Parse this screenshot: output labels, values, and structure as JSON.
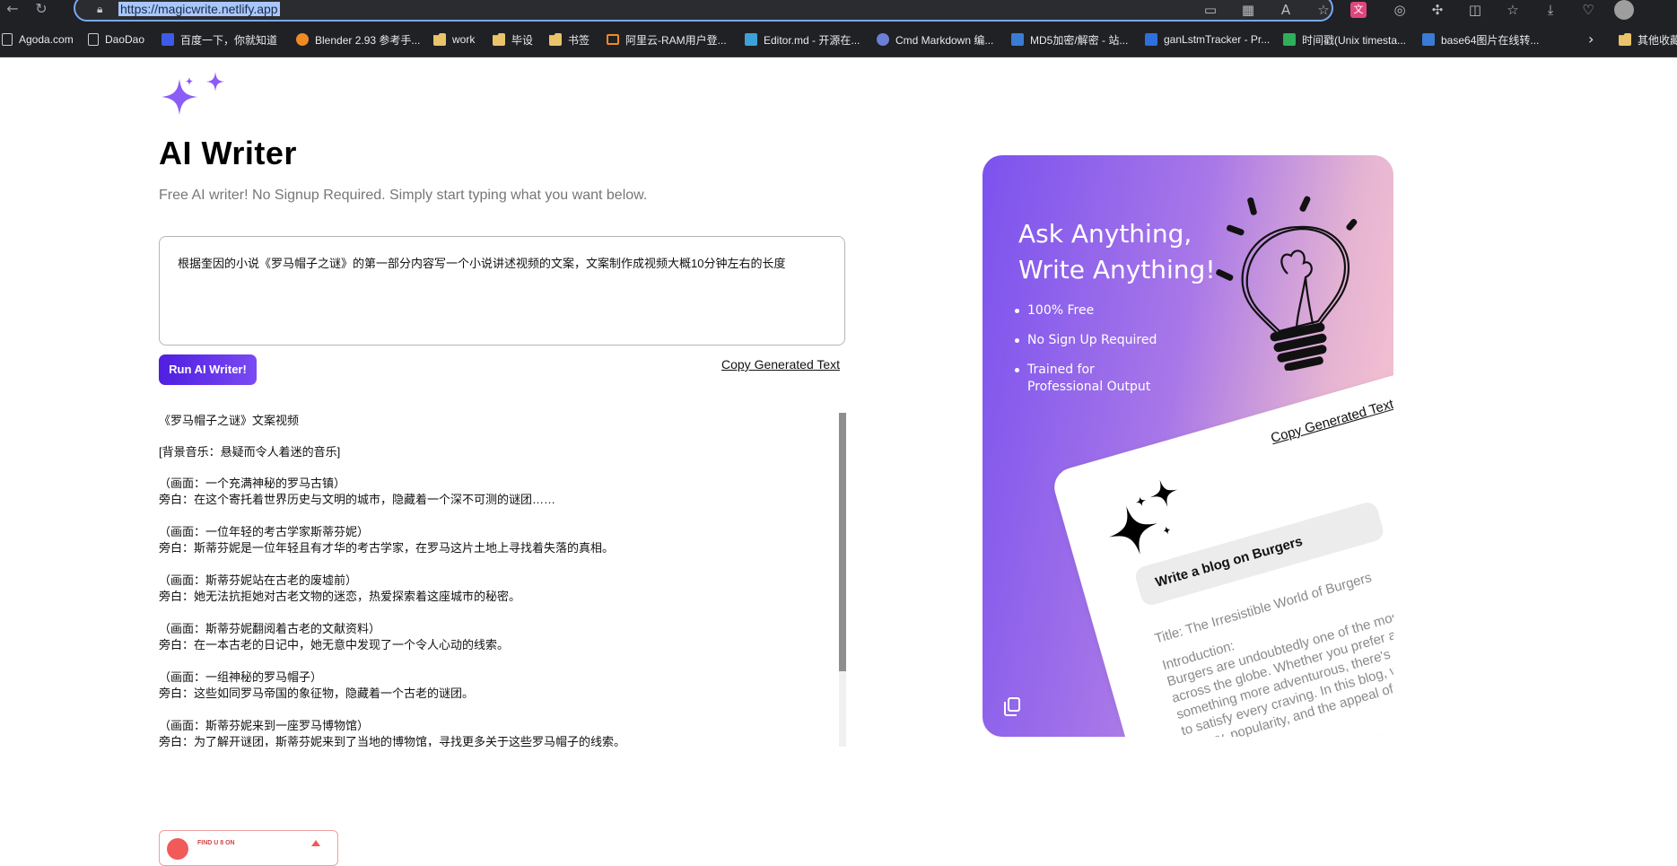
{
  "browser": {
    "url": "https://magicwrite.netlify.app",
    "bookmarks": [
      {
        "label": "Agoda.com",
        "kind": "page"
      },
      {
        "label": "DaoDao",
        "kind": "page"
      },
      {
        "label": "百度一下，你就知道",
        "kind": "baidu"
      },
      {
        "label": "Blender 2.93 参考手...",
        "kind": "blender"
      },
      {
        "label": "work",
        "kind": "folder"
      },
      {
        "label": "毕设",
        "kind": "folder"
      },
      {
        "label": "书签",
        "kind": "folder"
      },
      {
        "label": "阿里云-RAM用户登...",
        "kind": "aliyun"
      },
      {
        "label": "Editor.md - 开源在...",
        "kind": "editormd"
      },
      {
        "label": "Cmd Markdown 编...",
        "kind": "cmd"
      },
      {
        "label": "MD5加密/解密 - 站...",
        "kind": "md5"
      },
      {
        "label": "ganLstmTracker - Pr...",
        "kind": "on"
      },
      {
        "label": "时间戳(Unix timesta...",
        "kind": "time"
      },
      {
        "label": "base64图片在线转...",
        "kind": "md5"
      },
      {
        "label": "其他收藏",
        "kind": "folder"
      }
    ]
  },
  "page": {
    "title": "AI Writer",
    "subtitle": "Free AI writer! No Signup Required. Simply start typing what you want below.",
    "prompt_value": "根据奎因的小说《罗马帽子之谜》的第一部分内容写一个小说讲述视频的文案，文案制作成视频大概10分钟左右的长度",
    "run_button": "Run AI Writer!",
    "copy_link": "Copy Generated Text",
    "output": [
      [
        "《罗马帽子之谜》文案视频"
      ],
      [
        "[背景音乐：悬疑而令人着迷的音乐]"
      ],
      [
        "（画面：一个充满神秘的罗马古镇）",
        "旁白：在这个寄托着世界历史与文明的城市，隐藏着一个深不可测的谜团……"
      ],
      [
        "（画面：一位年轻的考古学家斯蒂芬妮）",
        "旁白：斯蒂芬妮是一位年轻且有才华的考古学家，在罗马这片土地上寻找着失落的真相。"
      ],
      [
        "（画面：斯蒂芬妮站在古老的废墟前）",
        "旁白：她无法抗拒她对古老文物的迷恋，热爱探索着这座城市的秘密。"
      ],
      [
        "（画面：斯蒂芬妮翻阅着古老的文献资料）",
        "旁白：在一本古老的日记中，她无意中发现了一个令人心动的线索。"
      ],
      [
        "（画面：一组神秘的罗马帽子）",
        "旁白：这些如同罗马帝国的象征物，隐藏着一个古老的谜团。"
      ],
      [
        "（画面：斯蒂芬妮来到一座罗马博物馆）",
        "旁白：为了解开谜团，斯蒂芬妮来到了当地的博物馆，寻找更多关于这些罗马帽子的线索。"
      ]
    ],
    "ad_text": "FIND U 8 ON"
  },
  "hero": {
    "headline_line1": "Ask Anything,",
    "headline_line2": "Write Anything!",
    "features": [
      "100% Free",
      "No Sign Up Required",
      "Trained for Professional Output"
    ],
    "demo_copy_link": "Copy Generated Text",
    "demo_prompt": "Write a blog on Burgers",
    "demo_output_title": "Title: The Irresistible World of Burgers",
    "demo_output_intro": "Introduction:",
    "demo_output_body": "Burgers are undoubtedly one of the most beloved foods across the globe. Whether you prefer a classic or opt for something more adventurous, there's a burger out there to satisfy every craving. In this blog, we'll explore the history, popularity, and the appeal of this culinary sensation."
  },
  "colors": {
    "accent": "#5b2be4",
    "hero_start": "#7b52ee",
    "hero_end": "#ffc9cf",
    "sparkle": "#8b5cf6"
  }
}
